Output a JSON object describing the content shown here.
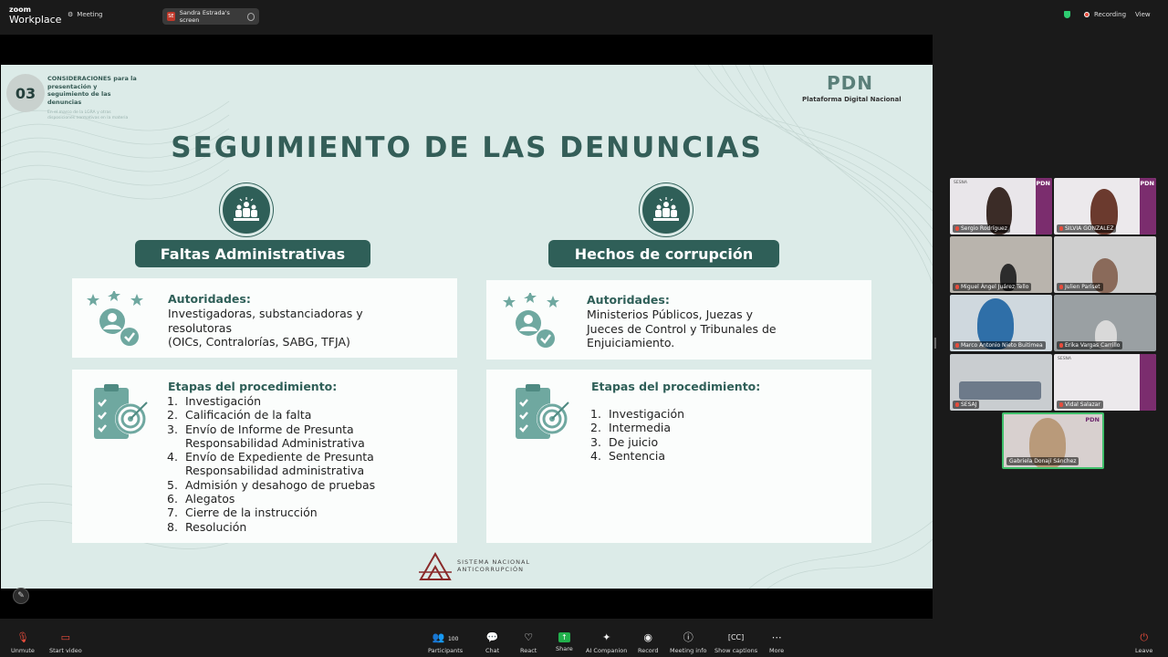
{
  "app": {
    "brand_line1": "zoom",
    "brand_line2": "Workplace",
    "meeting_label": "Meeting"
  },
  "share": {
    "initials": "SE",
    "label": "Sandra Estrada's screen"
  },
  "status": {
    "recording": "Recording",
    "view": "View"
  },
  "slide": {
    "section_number": "03",
    "section_title": "CONSIDERACIONES para la presentación y seguimiento de las denuncias",
    "section_note": "En el marco de la LGRA y otras disposiciones normativas en la materia",
    "pdn_logo": "PDN",
    "pdn_name": "Plataforma Digital Nacional",
    "title": "SEGUIMIENTO DE LAS DENUNCIAS",
    "left": {
      "heading": "Faltas Administrativas",
      "authorities_label": "Autoridades:",
      "authorities_text": [
        "Investigadoras, substanciadoras y",
        "resolutoras",
        "(OICs, Contralorías, SABG, TFJA)"
      ],
      "stages_label": "Etapas del procedimiento:",
      "stages": [
        {
          "n": "1.",
          "t": "Investigación"
        },
        {
          "n": "2.",
          "t": "Calificación de la falta"
        },
        {
          "n": "3.",
          "t": "Envío de Informe de Presunta Responsabilidad Administrativa"
        },
        {
          "n": "4.",
          "t": "Envío de Expediente de Presunta Responsabilidad administrativa"
        },
        {
          "n": "5.",
          "t": "Admisión y desahogo de pruebas"
        },
        {
          "n": "6.",
          "t": "Alegatos"
        },
        {
          "n": "7.",
          "t": "Cierre de la instrucción"
        },
        {
          "n": "8.",
          "t": "Resolución"
        }
      ]
    },
    "right": {
      "heading": "Hechos de corrupción",
      "authorities_label": "Autoridades:",
      "authorities_text": [
        "Ministerios Públicos, Juezas y",
        "Jueces de Control y Tribunales de",
        "Enjuiciamiento."
      ],
      "stages_label": "Etapas del procedimiento:",
      "stages": [
        {
          "n": "1.",
          "t": "Investigación"
        },
        {
          "n": "2.",
          "t": "Intermedia"
        },
        {
          "n": "3.",
          "t": "De juicio"
        },
        {
          "n": "4.",
          "t": "Sentencia"
        }
      ]
    },
    "footer_logo_line1": "SISTEMA NACIONAL",
    "footer_logo_line2": "ANTICORRUPCIÓN"
  },
  "participants": [
    {
      "name": "Sergio Rodríguez"
    },
    {
      "name": "SILVIA GONZALEZ"
    },
    {
      "name": "Miguel Ángel Juárez Tello"
    },
    {
      "name": "Julien Pariset"
    },
    {
      "name": "Marco Antonio Nieto Buitimea"
    },
    {
      "name": "Erika Vargas Carrillo"
    },
    {
      "name": "SESAJ"
    },
    {
      "name": "Vidal Salazar"
    },
    {
      "name": "Gabriela Donají Sánchez"
    }
  ],
  "tile_brand": "PDN",
  "tile_sesna": "SESNA",
  "toolbar": {
    "unmute": "Unmute",
    "start_video": "Start video",
    "participants_count": "100",
    "participants": "Participants",
    "chat": "Chat",
    "react": "React",
    "share": "Share",
    "ai_companion": "AI Companion",
    "record": "Record",
    "meeting_info": "Meeting info",
    "show_captions": "Show captions",
    "more": "More",
    "leave": "Leave"
  },
  "colors": {
    "slide_bg": "#dcebe8",
    "accent": "#2f5f58",
    "recording": "#e74c3c",
    "share_green": "#22b04c"
  }
}
